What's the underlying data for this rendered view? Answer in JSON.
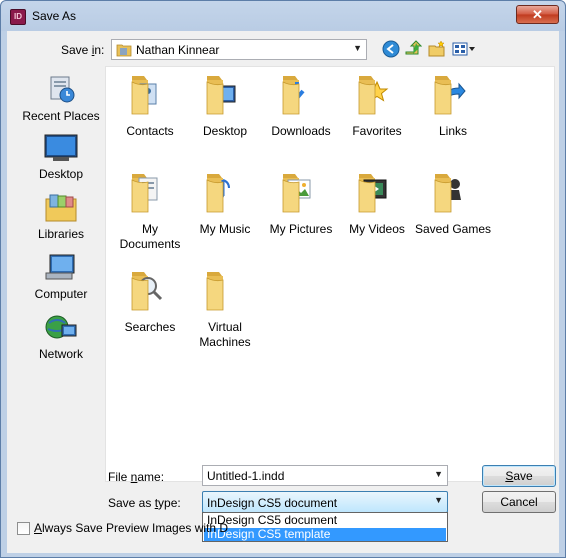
{
  "window": {
    "title": "Save As",
    "app_icon_text": "ID",
    "close_label": "✕"
  },
  "savein": {
    "label_pre": "Save ",
    "label_key": "i",
    "label_post": "n:",
    "value": "Nathan Kinnear"
  },
  "places": [
    {
      "label": "Recent Places",
      "icon": "recent-places-icon"
    },
    {
      "label": "Desktop",
      "icon": "desktop-icon"
    },
    {
      "label": "Libraries",
      "icon": "libraries-icon"
    },
    {
      "label": "Computer",
      "icon": "computer-icon"
    },
    {
      "label": "Network",
      "icon": "network-icon"
    }
  ],
  "folders": [
    {
      "line1": "Contacts",
      "line2": "",
      "icon": "contacts-folder-icon"
    },
    {
      "line1": "Desktop",
      "line2": "",
      "icon": "desktop-folder-icon"
    },
    {
      "line1": "Downloads",
      "line2": "",
      "icon": "downloads-folder-icon"
    },
    {
      "line1": "Favorites",
      "line2": "",
      "icon": "favorites-folder-icon"
    },
    {
      "line1": "Links",
      "line2": "",
      "icon": "links-folder-icon"
    },
    {
      "line1": "My",
      "line2": "Documents",
      "icon": "documents-folder-icon"
    },
    {
      "line1": "My Music",
      "line2": "",
      "icon": "music-folder-icon"
    },
    {
      "line1": "My Pictures",
      "line2": "",
      "icon": "pictures-folder-icon"
    },
    {
      "line1": "My Videos",
      "line2": "",
      "icon": "videos-folder-icon"
    },
    {
      "line1": "Saved Games",
      "line2": "",
      "icon": "saved-games-folder-icon"
    },
    {
      "line1": "Searches",
      "line2": "",
      "icon": "searches-folder-icon"
    },
    {
      "line1": "Virtual",
      "line2": "Machines",
      "icon": "virtual-machines-folder-icon"
    }
  ],
  "filename": {
    "label_pre": "File ",
    "label_key": "n",
    "label_post": "ame:",
    "value": "Untitled-1.indd"
  },
  "savetype": {
    "label_pre": "Save as ",
    "label_key": "t",
    "label_post": "ype:",
    "value": "InDesign CS5 document"
  },
  "type_options": [
    "InDesign CS5 document",
    "InDesign CS5 template"
  ],
  "buttons": {
    "save_key": "S",
    "save_rest": "ave",
    "cancel": "Cancel"
  },
  "checkbox": {
    "key": "A",
    "label": "lways Save Preview Images with D"
  },
  "colors": {
    "folder": "#f5d77f",
    "folder_dark": "#d9a93d",
    "selection": "#3399ff"
  }
}
